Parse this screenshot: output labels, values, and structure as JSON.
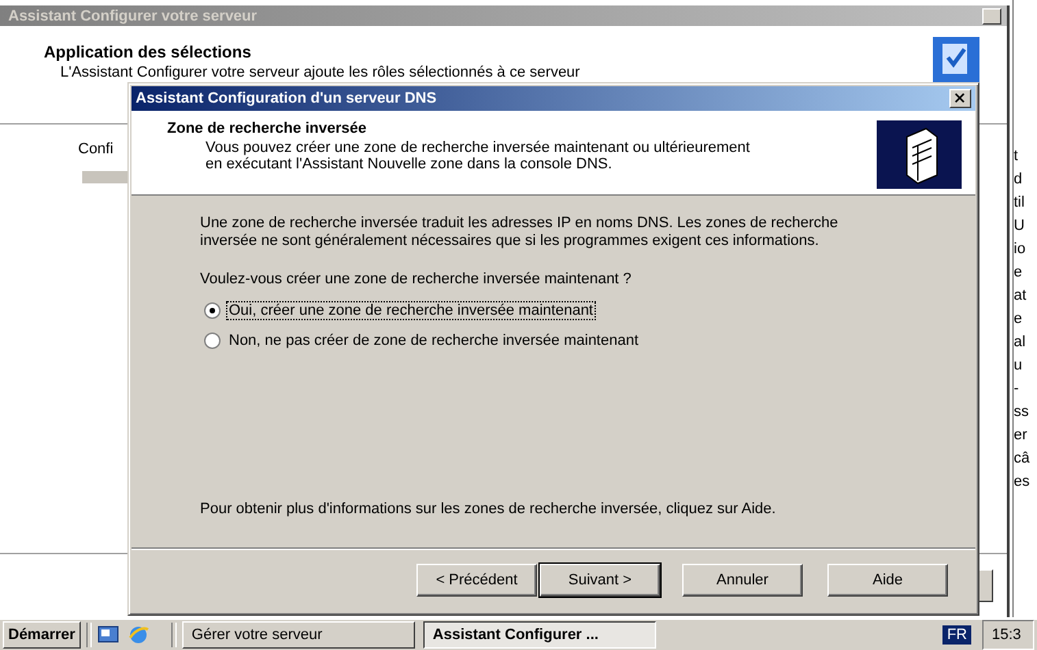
{
  "background_window": {
    "title": "Assistant Configurer votre serveur",
    "heading": "Application des sélections",
    "subtitle": "L'Assistant Configurer votre serveur ajoute les rôles sélectionnés à ce serveur",
    "status_label": "Confi",
    "progress": {
      "level": 0
    }
  },
  "dialog": {
    "title": "Assistant Configuration d'un serveur DNS",
    "heading": "Zone de recherche inversée",
    "subtitle": "Vous pouvez créer une zone de recherche inversée maintenant ou ultérieurement en exécutant l'Assistant Nouvelle zone dans la console DNS.",
    "description": "Une zone de recherche inversée traduit les adresses IP en noms DNS. Les zones de recherche inversée ne sont généralement nécessaires que si les programmes exigent ces informations.",
    "question": "Voulez-vous créer une zone de recherche inversée maintenant ?",
    "options": [
      {
        "label": "Oui, créer une zone de recherche inversée maintenant",
        "selected": true
      },
      {
        "label": "Non, ne pas créer de zone de recherche inversée maintenant",
        "selected": false
      }
    ],
    "help_text": "Pour obtenir plus d'informations sur les zones de recherche inversée, cliquez sur Aide.",
    "buttons": [
      {
        "label": "< Précédent",
        "default": false
      },
      {
        "label": "Suivant >",
        "default": true
      },
      {
        "label": "Annuler",
        "default": false
      },
      {
        "label": "Aide",
        "default": false
      }
    ]
  },
  "side_window_fragments": [
    "t",
    "d",
    "til",
    "U",
    "io",
    "e",
    "at",
    "e",
    "al",
    "u",
    "-",
    "ss",
    "er",
    "câ",
    "es"
  ],
  "taskbar": {
    "start": "Démarrer",
    "tasks": [
      {
        "label": "Gérer votre serveur",
        "active": false
      },
      {
        "label": "Assistant Configurer ...",
        "active": true
      }
    ],
    "language": "FR",
    "clock": "15:3"
  }
}
